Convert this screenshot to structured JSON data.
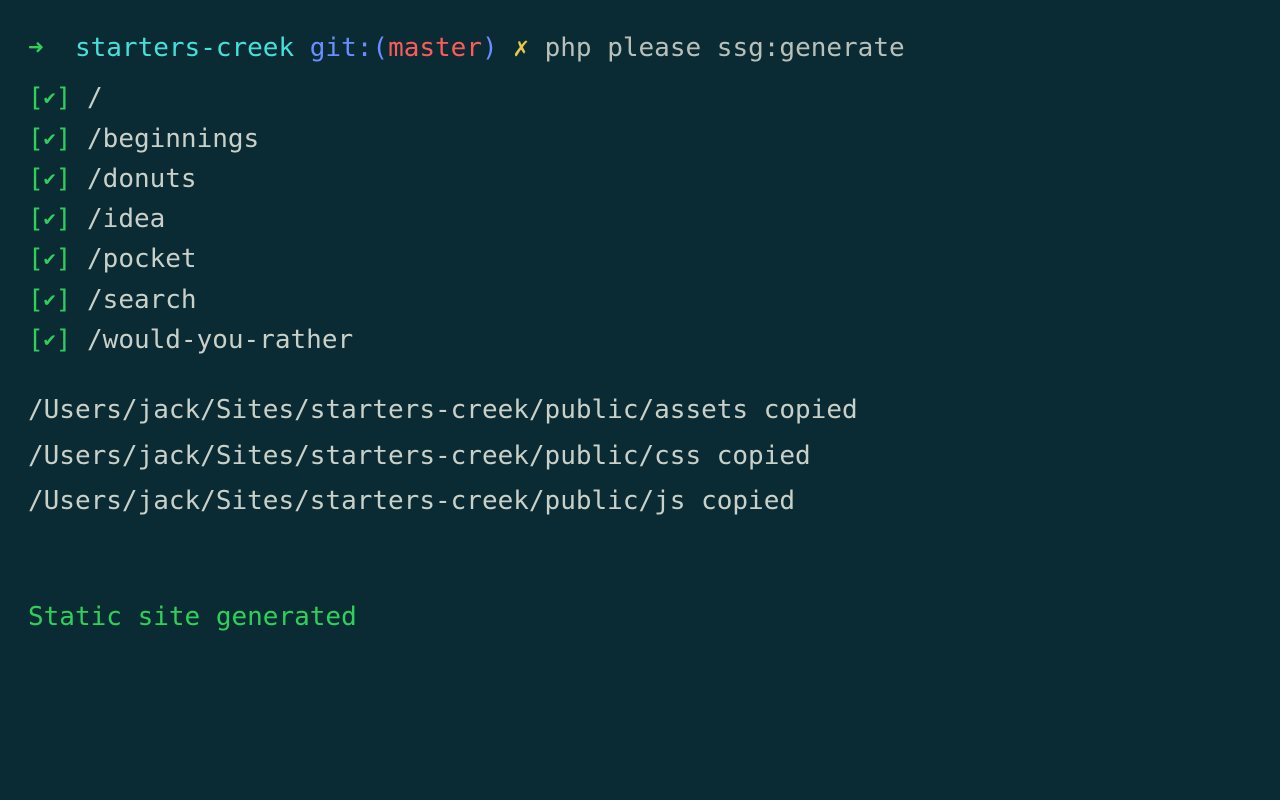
{
  "prompt": {
    "arrow": "➜",
    "directory": "starters-creek",
    "git_label": "git:(",
    "branch": "master",
    "git_close": ")",
    "dirty": "✗",
    "command": "php please ssg:generate"
  },
  "routes": [
    "/",
    "/beginnings",
    "/donuts",
    "/idea",
    "/pocket",
    "/search",
    "/would-you-rather"
  ],
  "check": {
    "open": "[",
    "mark": "✔",
    "close": "]"
  },
  "copied": [
    "/Users/jack/Sites/starters-creek/public/assets copied",
    "/Users/jack/Sites/starters-creek/public/css copied",
    "/Users/jack/Sites/starters-creek/public/js copied"
  ],
  "final_message": "Static site generated"
}
